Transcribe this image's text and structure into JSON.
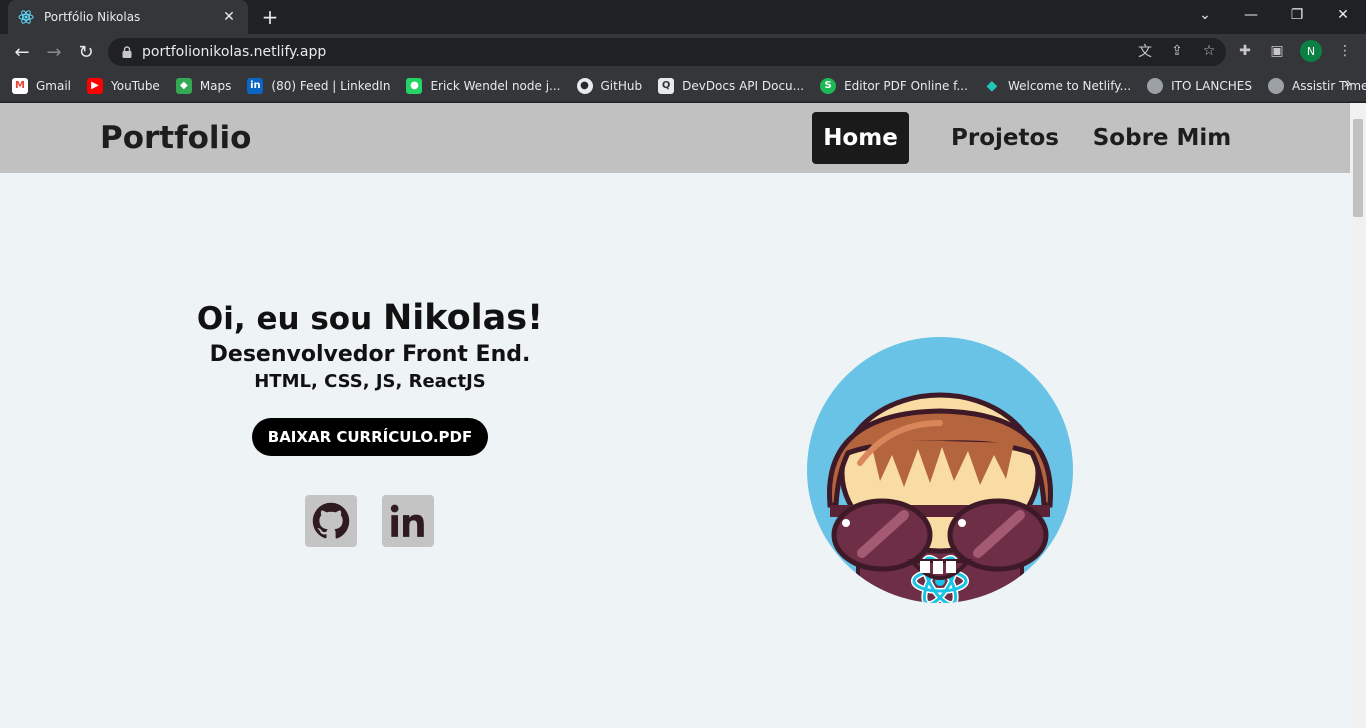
{
  "browser": {
    "tab_title": "Portfólio Nikolas",
    "url": "portfolionikolas.netlify.app",
    "profile_initial": "N",
    "bookmarks": [
      {
        "label": "Gmail",
        "icon": "gmail-icon",
        "color": "#ea4335"
      },
      {
        "label": "YouTube",
        "icon": "youtube-icon",
        "color": "#ff0000"
      },
      {
        "label": "Maps",
        "icon": "maps-icon",
        "color": "#34a853"
      },
      {
        "label": "(80) Feed | LinkedIn",
        "icon": "linkedin-icon",
        "color": "#0a66c2"
      },
      {
        "label": "Erick Wendel node j...",
        "icon": "whatsapp-icon",
        "color": "#25d366"
      },
      {
        "label": "GitHub",
        "icon": "github-icon",
        "color": "#24292e"
      },
      {
        "label": "DevDocs API Docu...",
        "icon": "devdocs-icon",
        "color": "#e8eaed"
      },
      {
        "label": "Editor PDF Online f...",
        "icon": "sejda-icon",
        "color": "#1db954"
      },
      {
        "label": "Welcome to Netlify...",
        "icon": "netlify-icon",
        "color": "#20c6b7"
      },
      {
        "label": "ITO LANCHES",
        "icon": "globe-icon",
        "color": "#9aa0a6"
      },
      {
        "label": "Assistir Times onlin...",
        "icon": "globe-icon",
        "color": "#9aa0a6"
      }
    ]
  },
  "site": {
    "brand": "Portfolio",
    "nav": {
      "home": "Home",
      "projects": "Projetos",
      "about": "Sobre Mim"
    },
    "hero": {
      "greeting": "Oi, eu sou",
      "name": "Nikolas!",
      "role": "Desenvolvedor Front End.",
      "stack": "HTML, CSS, JS, ReactJS",
      "cv_button": "BAIXAR CURRÍCULO.PDF"
    },
    "accent_color": "#1a1a1a",
    "background_color": "#eef3f6"
  }
}
